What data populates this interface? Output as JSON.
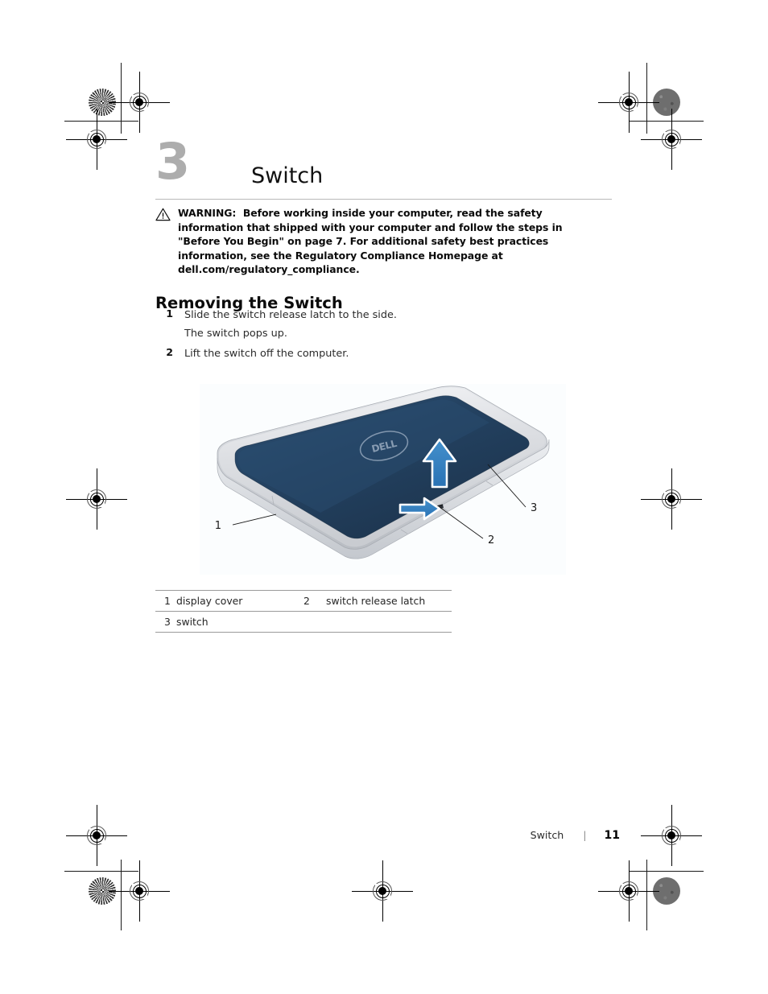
{
  "page": {
    "chapter_number": "3",
    "chapter_title": "Switch"
  },
  "warning": {
    "icon": "warning-triangle-icon",
    "label": "WARNING:",
    "text": "Before working inside your computer, read the safety information that shipped with your computer and follow the steps in \"Before You Begin\" on page 7. For additional safety best practices information, see the Regulatory Compliance Homepage at dell.com/regulatory_compliance."
  },
  "section": {
    "heading": "Removing the Switch",
    "steps": [
      {
        "number": "1",
        "text": "Slide the switch release latch to the side.",
        "sub": "The switch pops up."
      },
      {
        "number": "2",
        "text": "Lift the switch off the computer.",
        "sub": ""
      }
    ]
  },
  "figure": {
    "alt": "Dell laptop with blue switch cover, showing switch release latch and removal direction arrows",
    "brand_logo": "DELL",
    "callouts": [
      {
        "number": "1",
        "target": "display cover"
      },
      {
        "number": "2",
        "target": "switch release latch"
      },
      {
        "number": "3",
        "target": "switch"
      }
    ],
    "arrows": [
      {
        "name": "lift-arrow",
        "direction": "up"
      },
      {
        "name": "slide-arrow",
        "direction": "right"
      }
    ],
    "colors": {
      "switch_cover": "#23405f",
      "switch_cover_dark": "#1b3047",
      "chassis": "#d8dade",
      "chassis_light": "#eef0f2",
      "arrow_fill": "#2f7fc1",
      "background": "#fbfdfe"
    }
  },
  "legend": {
    "rows": [
      {
        "num1": "1",
        "label1": "display cover",
        "num2": "2",
        "label2": "switch release latch"
      },
      {
        "num1": "3",
        "label1": "switch",
        "num2": "",
        "label2": ""
      }
    ]
  },
  "footer": {
    "chapter": "Switch",
    "separator": "|",
    "page_number": "11"
  }
}
